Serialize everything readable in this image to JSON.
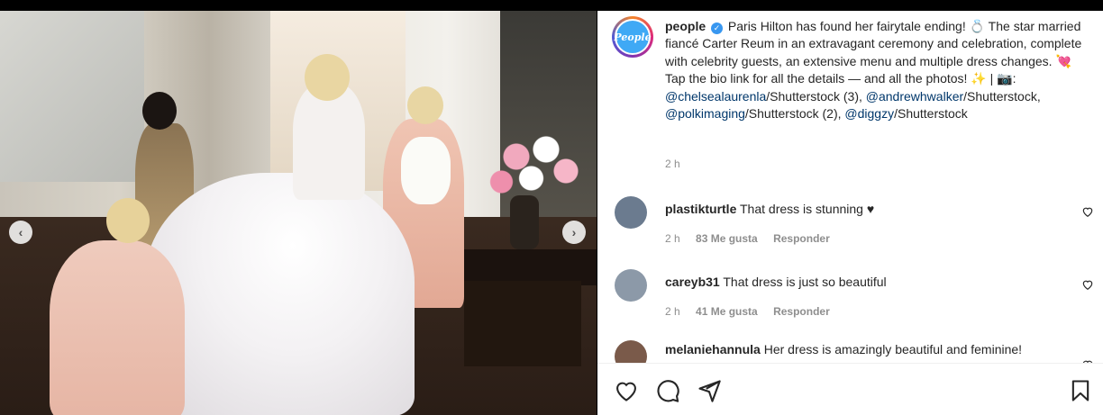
{
  "post": {
    "username": "people",
    "avatar_text": "People",
    "caption": "Paris Hilton has found her fairytale ending! 💍 The star married fiancé Carter Reum in an extravagant ceremony and celebration, complete with celebrity guests, an extensive menu and multiple dress changes. 💘 Tap the bio link for all the details — and all the photos! ✨ | 📷: ",
    "credits": [
      {
        "handle": "@chelsealaurenla",
        "suffix": "/Shutterstock (3),"
      },
      {
        "handle": "@andrewhwalker",
        "suffix": "/Shutterstock,"
      },
      {
        "handle": "@polkimaging",
        "suffix": "/Shutterstock (2),"
      },
      {
        "handle": "@diggzy",
        "suffix": "/Shutterstock"
      }
    ],
    "time": "2 h"
  },
  "comments": [
    {
      "user": "plastikturtle",
      "text": "That dress is stunning ♥",
      "time": "2 h",
      "likes": "83 Me gusta",
      "reply": "Responder",
      "avatar_color": "#6b7b8f"
    },
    {
      "user": "careyb31",
      "text": "That dress is just so beautiful",
      "time": "2 h",
      "likes": "41 Me gusta",
      "reply": "Responder",
      "avatar_color": "#8c99a8"
    },
    {
      "user": "melaniehannula",
      "text": "Her dress is amazingly beautiful and feminine!",
      "time": "",
      "likes": "",
      "reply": "",
      "avatar_color": "#7a5a4a"
    }
  ],
  "icons": {
    "like": "heart-icon",
    "comment": "comment-icon",
    "share": "share-icon",
    "save": "bookmark-icon",
    "prev": "chevron-left-icon",
    "next": "chevron-right-icon"
  }
}
